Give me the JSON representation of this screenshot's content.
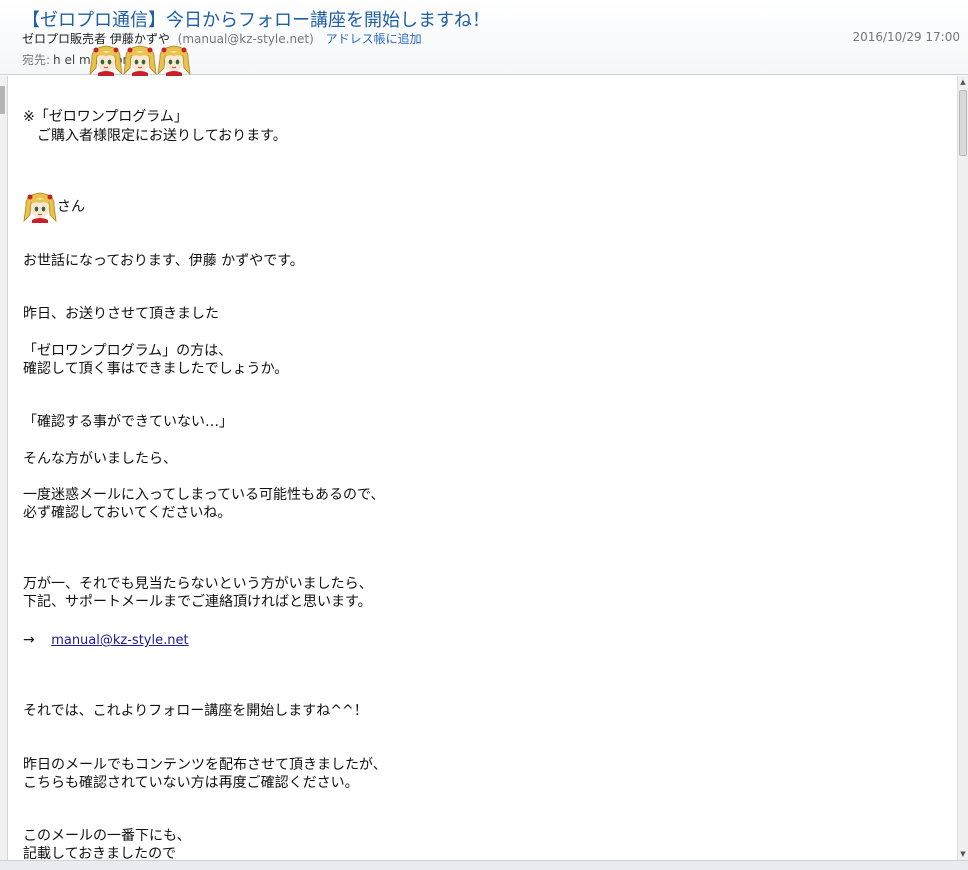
{
  "message": {
    "subject": "【ゼロプロ通信】今日からフォロー講座を開始しますね！",
    "sender_name": "ゼロプロ販売者 伊藤かずや",
    "sender_email": "(manual@kz-style.net)",
    "address_book_label": "アドレス帳に追加",
    "date": "2016/10/29 17:00",
    "to_label": "宛先:",
    "to_address": "h        el      mail.com;"
  },
  "body_lines": [
    "※「ゼロワンプログラム」",
    "　ご購入者様限定にお送りしております。",
    "さん",
    "お世話になっております、伊藤 かずやです。",
    "昨日、お送りさせて頂きました",
    "「ゼロワンプログラム」の方は、",
    "確認して頂く事はできましたでしょうか。",
    "「確認する事ができていない…」",
    "そんな方がいましたら、",
    "一度迷惑メールに入ってしまっている可能性もあるので、",
    "必ず確認しておいてくださいね。",
    "万が一、それでも見当たらないという方がいましたら、",
    "下記、サポートメールまでご連絡頂ければと思います。",
    "→",
    "manual@kz-style.net",
    "それでは、これよりフォロー講座を開始しますね^^！",
    "昨日のメールでもコンテンツを配布させて頂きましたが、",
    "こちらも確認されていない方は再度ご確認ください。",
    "このメールの一番下にも、",
    "記載しておきましたので"
  ],
  "icons": {
    "avatar": "anime-avatar-icon",
    "scroll_up": "scroll-up-arrow-icon",
    "scroll_down": "scroll-down-arrow-icon"
  },
  "colors": {
    "subject": "#1f5fa8",
    "link": "#1a1aa0",
    "address_book": "#2a6ac1"
  }
}
